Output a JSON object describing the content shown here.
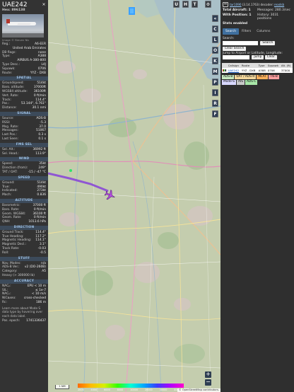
{
  "aircraft": {
    "callsign": "UAE242",
    "hex_label": "Hex: 896138",
    "close_glyph": "×",
    "photo_credit": "Image © Steven Nb",
    "identity": [
      {
        "k": "Reg.:",
        "v": "A6-EER"
      },
      {
        "k": "",
        "v": "United Arab Emirates"
      },
      {
        "k": "DB flags:",
        "v": "none"
      },
      {
        "k": "Type:",
        "v": "A388"
      },
      {
        "k": "",
        "v": "AIRBUS A-380-800"
      },
      {
        "k": "Type Desc.:",
        "v": "L4J"
      },
      {
        "k": "Squawk:",
        "v": "0706"
      },
      {
        "k": "Route:",
        "v": "YYZ - DXB"
      }
    ],
    "sections": [
      {
        "title": "SPATIAL",
        "rows": [
          {
            "k": "Groundspeed:",
            "v": "514kt"
          },
          {
            "k": "Baro. altitude:",
            "v": "37000ft"
          },
          {
            "k": "WGS84 altitude:",
            "v": "36100ft"
          },
          {
            "k": "Vert. Rate:",
            "v": "0 ft/min"
          },
          {
            "k": "Track:",
            "v": "114.4°"
          },
          {
            "k": "Pos.:",
            "v": "53.144°, 6.761°"
          },
          {
            "k": "Distance:",
            "v": "30.1 nmi"
          }
        ]
      },
      {
        "title": "SIGNAL",
        "rows": [
          {
            "k": "Source:",
            "v": "ADS-B"
          },
          {
            "k": "RSSI:",
            "v": "-5.3"
          },
          {
            "k": "Msg. Rate:",
            "v": "37.0"
          },
          {
            "k": "Messages:",
            "v": "51067"
          },
          {
            "k": "Last Pos.:",
            "v": "0.3 s"
          },
          {
            "k": "Last Seen:",
            "v": "0.1 s"
          }
        ]
      },
      {
        "title": "FMS SEL",
        "rows": [
          {
            "k": "Sel. Alt.:",
            "v": "36992 ft"
          },
          {
            "k": "Sel. Head.:",
            "v": "113.9°"
          }
        ]
      },
      {
        "title": "WIND",
        "rows": [
          {
            "k": "Speed:",
            "v": "35kt"
          },
          {
            "k": "Direction (from):",
            "v": "249°"
          },
          {
            "k": "TAT / OAT:",
            "v": "-15 / -47 °C"
          }
        ]
      },
      {
        "title": "SPEED",
        "rows": [
          {
            "k": "Ground:",
            "v": "514kt"
          },
          {
            "k": "True:",
            "v": "490kt"
          },
          {
            "k": "Indicated:",
            "v": "273kt"
          },
          {
            "k": "Mach:",
            "v": "0.836"
          }
        ]
      },
      {
        "title": "ALTITUDE",
        "rows": [
          {
            "k": "Barometric:",
            "v": "37000 ft"
          },
          {
            "k": "Baro. Rate:",
            "v": "0 ft/min"
          },
          {
            "k": "Geom. WGS84:",
            "v": "36100 ft"
          },
          {
            "k": "Geom. Rate:",
            "v": "0 ft/min"
          },
          {
            "k": "QNH:",
            "v": "1013.6 hPa"
          }
        ]
      },
      {
        "title": "DIRECTION",
        "rows": [
          {
            "k": "Ground Track:",
            "v": "114.4°"
          },
          {
            "k": "True Heading:",
            "v": "117.2°"
          },
          {
            "k": "Magnetic Heading:",
            "v": "114.1°"
          },
          {
            "k": "Magnetic Decl.:",
            "v": "3.1°"
          },
          {
            "k": "Track Rate:",
            "v": "-0.03"
          },
          {
            "k": "Roll:",
            "v": "-0.5"
          }
        ]
      },
      {
        "title": "STUFF",
        "rows": [
          {
            "k": "Nav. Modes:",
            "v": "n/a"
          },
          {
            "k": "ADS-B Ver.:",
            "v": "v2 (DO-260B)"
          },
          {
            "k": "Category:",
            "v": "A5"
          },
          {
            "k": "Heavy (> 300000 lb)",
            "v": ""
          }
        ]
      },
      {
        "title": "ACCURACY",
        "rows": [
          {
            "k": "NACₚ:",
            "v": "EPU < 10 m"
          },
          {
            "k": "SIL:",
            "v": "≤ 1e-7"
          },
          {
            "k": "NACᵥ:",
            "v": "< 10 m/s"
          },
          {
            "k": "NICʙᴀʀᴏ:",
            "v": "cross-checked"
          },
          {
            "k": "Rᴄ:",
            "v": "186 m"
          }
        ]
      }
    ],
    "note": "Learn more about Mode S data type by hovering over each data label.",
    "pos_epoch": {
      "k": "Pos. epoch:",
      "v": "1741336437"
    }
  },
  "map": {
    "top_buttons": [
      "U",
      "H",
      "T"
    ],
    "gear_glyph": "⚙",
    "side_buttons": [
      "«",
      "C",
      "L",
      "O",
      "K",
      "M",
      "P",
      "I",
      "R",
      "F"
    ],
    "zoom_in": "+",
    "zoom_out": "−",
    "scale_label": "1 NM",
    "alt_ticks": [
      "2000",
      "4000",
      "6000",
      "8000",
      "10000",
      "20000",
      "30000",
      "40000+"
    ],
    "attribution": "© OpenStreetMap contributors."
  },
  "right": {
    "version_link": "tar1090",
    "version_text": "(3.14.1763) decoder:",
    "readsb_link": "readsb",
    "stats": [
      {
        "k": "Total Aircraft: 1",
        "v": "Messages: 280.3/sec"
      },
      {
        "k": "With Position: 1",
        "v": "History: 3031 positions"
      },
      {
        "k": "Stats enabled",
        "v": ""
      }
    ],
    "tabs": [
      "Search",
      "Filters",
      "Columns"
    ],
    "search_label": "Search:",
    "search_btn": "Search",
    "clear_search": "Clear Search",
    "jump_label": "Jump to Airport or Latitude, Longitude:",
    "jump_btn": "Jump",
    "clear_btn": "Clear",
    "table_headers": [
      "",
      "Callsign",
      "Route",
      "Type",
      "Squawk",
      "Alt. (ft)"
    ],
    "table_rows": [
      {
        "callsign": "UAE242",
        "route": "YYZ - DXB",
        "type": "A388",
        "squawk": "0706",
        "alt": "37000"
      }
    ],
    "legend": [
      {
        "label": "ADS-B",
        "color": "#c7e9c0"
      },
      {
        "label": "UAT / ADS-R",
        "color": "#f3d79c"
      },
      {
        "label": "MLAT",
        "color": "#ffb15c"
      },
      {
        "label": "TIS-B",
        "color": "#ffa0a0"
      },
      {
        "label": "Mode-S",
        "color": "#d8d8ff"
      },
      {
        "label": "AIS",
        "color": "#c9c9c9"
      },
      {
        "label": "ADS-C",
        "color": "#a8e6a8"
      }
    ]
  }
}
